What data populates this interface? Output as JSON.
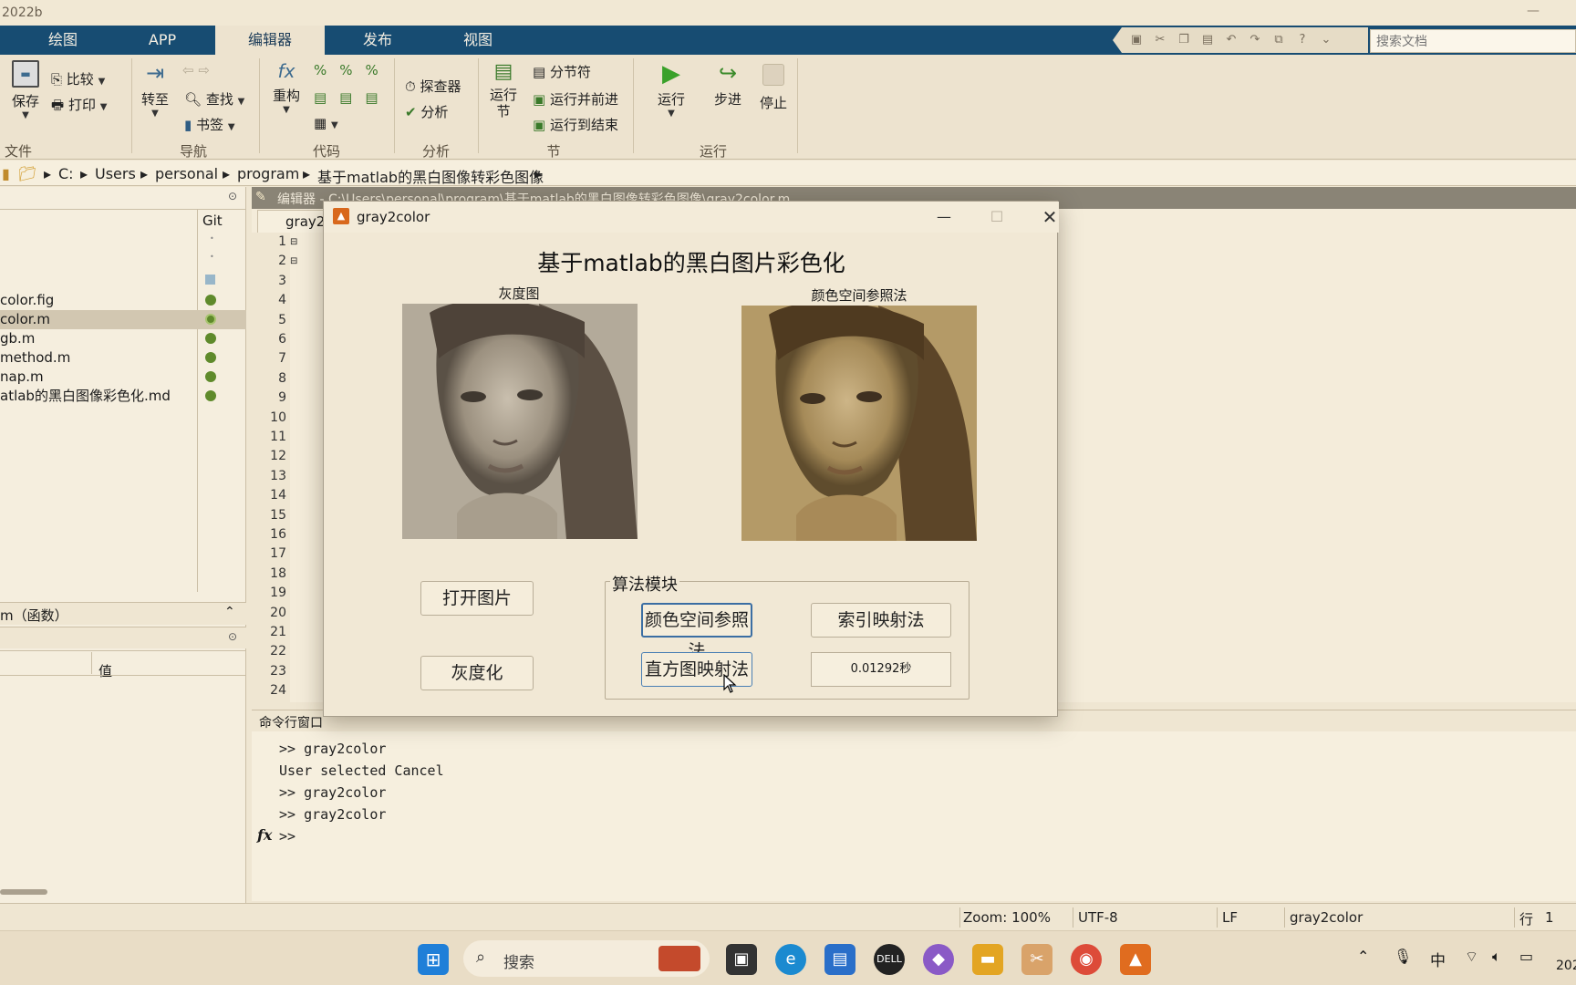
{
  "app": {
    "title_fragment": "2022b",
    "tabs": [
      "绘图",
      "APP",
      "编辑器",
      "发布",
      "视图"
    ],
    "active_tab": "编辑器",
    "search_placeholder": "搜索文档"
  },
  "ribbon": {
    "file": {
      "group_label": "文件",
      "save": "保存",
      "compare": "比较",
      "print": "打印"
    },
    "nav": {
      "group_label": "导航",
      "goto": "转至",
      "find": "查找",
      "bookmark": "书签"
    },
    "code": {
      "group_label": "代码",
      "refactor": "重构"
    },
    "analyze": {
      "group_label": "分析",
      "explorer": "探查器",
      "analyze": "分析"
    },
    "section": {
      "group_label": "节",
      "run_section_1": "运行",
      "run_section_2": "节",
      "section_break": "分节符",
      "run_advance": "运行并前进",
      "run_to_end": "运行到结束"
    },
    "run": {
      "group_label": "运行",
      "run": "运行",
      "step": "步进",
      "stop": "停止"
    }
  },
  "path": [
    "C:",
    "Users",
    "personal",
    "program",
    "基于matlab的黑白图像转彩色图像"
  ],
  "file_browser": {
    "git_header": "Git",
    "files": [
      {
        "name": "color.fig",
        "selected": false
      },
      {
        "name": "color.m",
        "selected": true
      },
      {
        "name": "gb.m",
        "selected": false
      },
      {
        "name": "method.m",
        "selected": false
      },
      {
        "name": "nap.m",
        "selected": false
      },
      {
        "name": "atlab的黑白图像彩色化.md",
        "selected": false
      }
    ],
    "details_label": "m（函数）",
    "workspace_value_header": "值"
  },
  "editor": {
    "header": "编辑器 - C:\\Users\\personal\\program\\基于matlab的黑白图像转彩色图像\\gray2color.m",
    "tab": "gray2",
    "line_count": 24
  },
  "command_window": {
    "title": "命令行窗口",
    "lines": [
      ">> gray2color",
      "User selected Cancel",
      ">> gray2color",
      ">> gray2color"
    ],
    "prompt": ">>",
    "fx": "fx"
  },
  "statusbar": {
    "zoom": "Zoom: 100%",
    "encoding": "UTF-8",
    "eol": "LF",
    "file": "gray2color",
    "row_label": "行",
    "row": "1"
  },
  "taskbar": {
    "search": "搜索",
    "ime": "中",
    "time_fragment": "202"
  },
  "dialog": {
    "title": "gray2color",
    "heading": "基于matlab的黑白图片彩色化",
    "gray_label": "灰度图",
    "color_label": "颜色空间参照法",
    "open_button": "打开图片",
    "gray_button": "灰度化",
    "algo_group": "算法模块",
    "btn_color_space": "颜色空间参照法",
    "btn_index_map": "索引映射法",
    "btn_hist_map": "直方图映射法",
    "time_value": "0.01292秒"
  }
}
